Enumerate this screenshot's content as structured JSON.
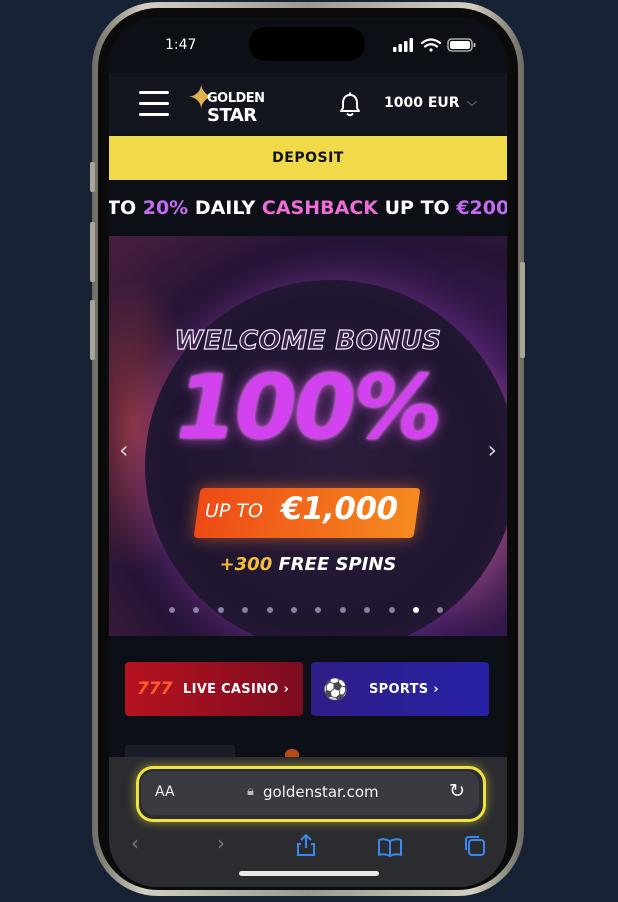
{
  "status_bar": {
    "time": "1:47"
  },
  "header": {
    "logo_line1": "GOLDEN",
    "logo_line2": "STAR",
    "balance": "1000 EUR"
  },
  "deposit_label": "DEPOSIT",
  "ticker": {
    "p1": "TO ",
    "p2": "20%",
    "p3": " DAILY ",
    "p4": "CASHBACK",
    "p5": " UP TO ",
    "p6": "€200"
  },
  "banner": {
    "headline": "WELCOME BONUS",
    "percent": "100%",
    "upto_small": "UP TO",
    "upto_amount": "€1,000",
    "spins_prefix": "+300",
    "spins_suffix": " FREE SPINS",
    "slide_count": 12,
    "active_slide": 11
  },
  "categories": {
    "live_casino": "LIVE CASINO",
    "sports": "SPORTS",
    "chevron": "›"
  },
  "safari": {
    "text_size": "AA",
    "url": "goldenstar.com"
  },
  "colors": {
    "deposit": "#f0da4a",
    "ticker_purple": "#c26cf2",
    "ticker_pink": "#ee6cd5",
    "url_highlight": "#f2e23c",
    "safari_accent": "#3a88f0"
  }
}
